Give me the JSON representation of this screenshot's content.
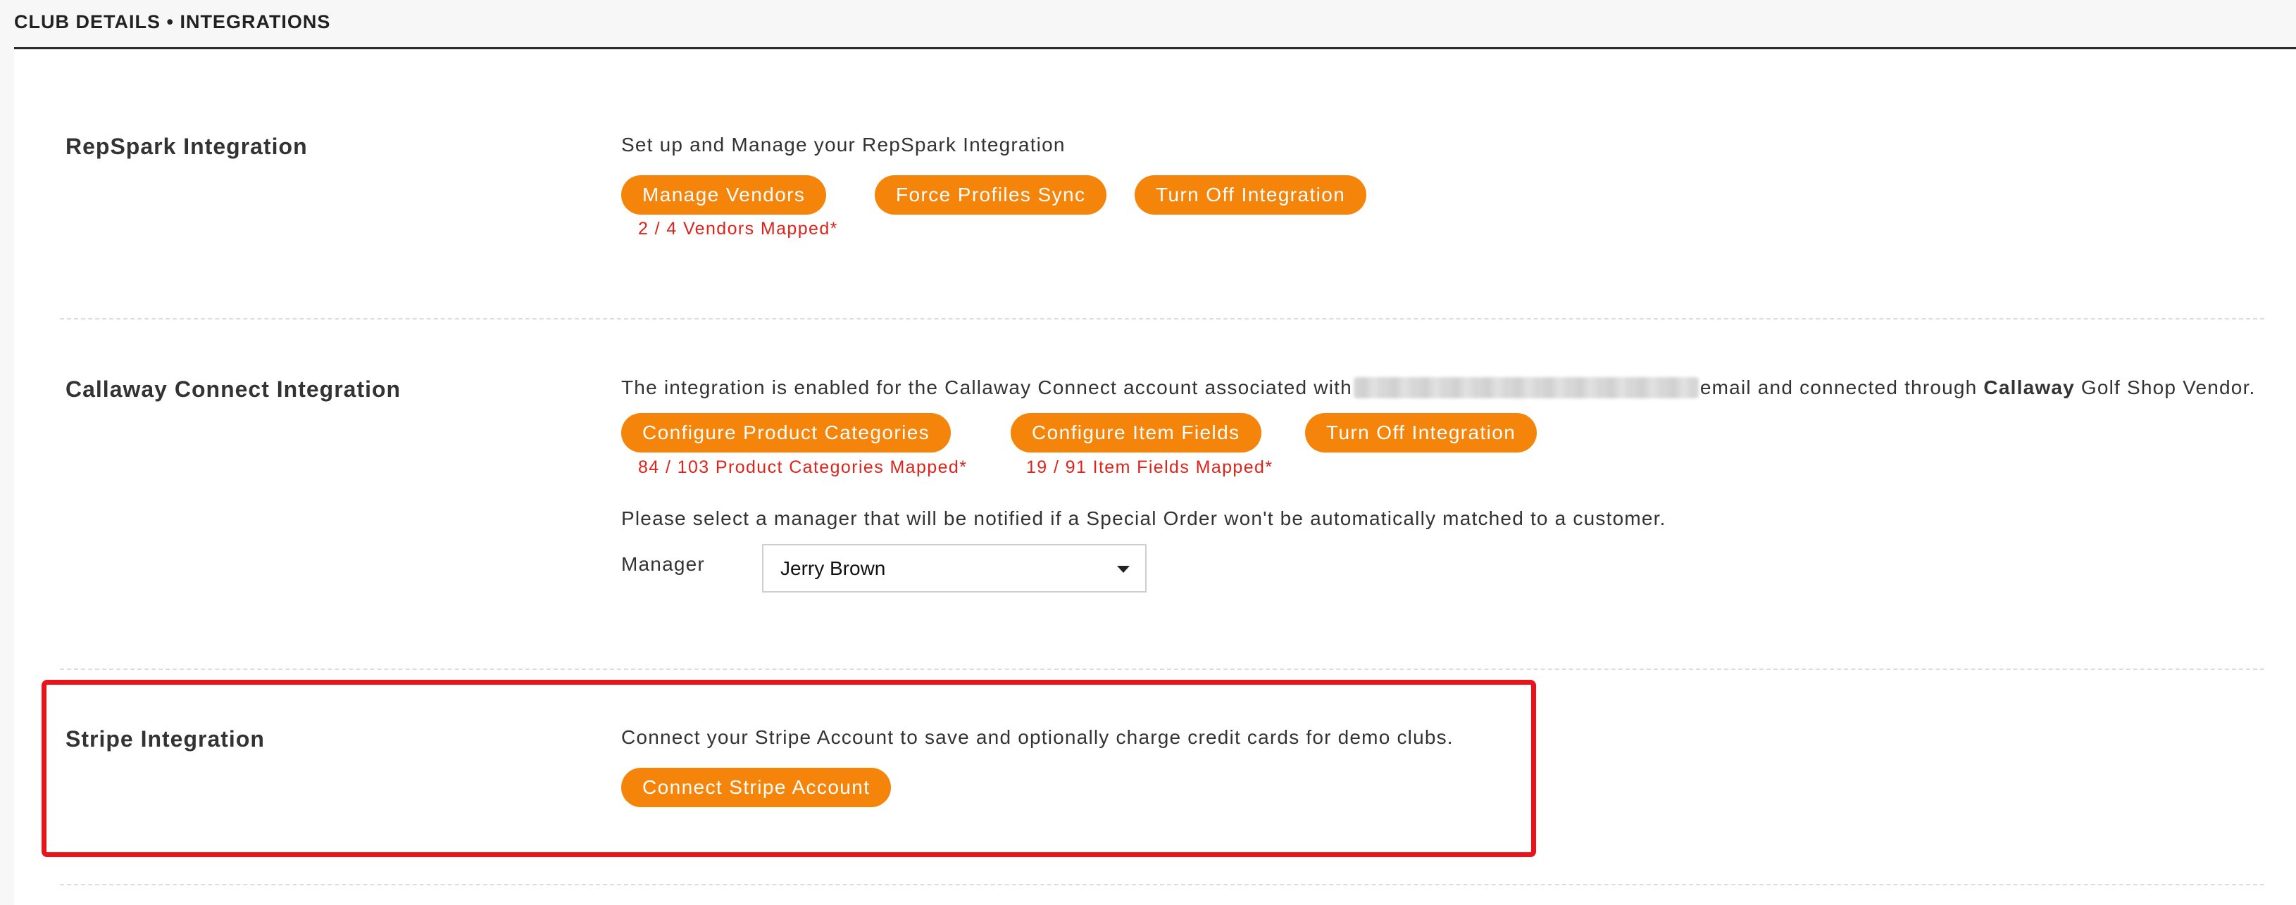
{
  "header": {
    "breadcrumb": "CLUB DETAILS • INTEGRATIONS"
  },
  "repspark": {
    "title": "RepSpark Integration",
    "description": "Set up and Manage your RepSpark Integration",
    "buttons": {
      "manage_vendors": "Manage Vendors",
      "force_sync": "Force Profiles Sync",
      "turn_off": "Turn Off Integration"
    },
    "vendors_mapped_note": "2 / 4 Vendors Mapped*"
  },
  "callaway": {
    "title": "Callaway Connect Integration",
    "description_start": "The integration is enabled for the Callaway Connect account associated with",
    "description_mid": "email and connected through",
    "description_vendor_bold": "Callaway",
    "description_end": "Golf Shop Vendor.",
    "buttons": {
      "configure_categories": "Configure Product Categories",
      "configure_fields": "Configure Item Fields",
      "turn_off": "Turn Off Integration"
    },
    "categories_note": "84 / 103 Product Categories Mapped*",
    "fields_note": "19 / 91 Item Fields Mapped*",
    "manager_prompt": "Please select a manager that will be notified if a Special Order won't be automatically matched to a customer.",
    "manager_label": "Manager",
    "manager_selected": "Jerry Brown"
  },
  "stripe": {
    "title": "Stripe Integration",
    "description": "Connect your Stripe Account to save and optionally charge credit cards for demo clubs.",
    "button": "Connect Stripe Account"
  },
  "colors": {
    "accent_button": "#f5840b",
    "note_red": "#e0231a",
    "highlight_red": "#e8141a"
  }
}
